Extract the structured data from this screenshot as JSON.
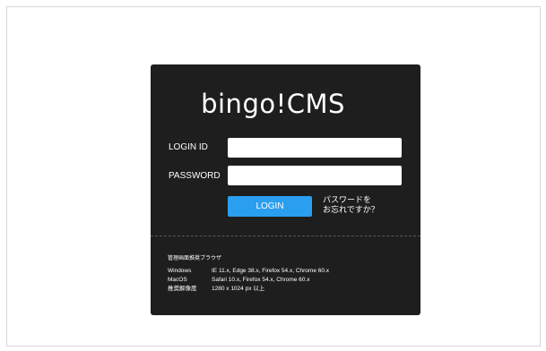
{
  "app": {
    "logo": "bingo!CMS"
  },
  "form": {
    "login_id_label": "LOGIN ID",
    "password_label": "PASSWORD",
    "login_id_value": "",
    "password_value": "",
    "login_button": "LOGIN",
    "forgot_line1": "パスワードを",
    "forgot_line2": "お忘れですか？"
  },
  "browsers": {
    "title": "管理画面推奨ブラウザ",
    "rows": [
      {
        "key": "Windows",
        "value": "IE 11.x, Edge 38.x, Firefox 54.x, Chrome 60.x"
      },
      {
        "key": "MacOS",
        "value": "Safari 10.x, Firefox 54.x, Chrome 60.x"
      },
      {
        "key": "推奨解像度",
        "value": "1280 x 1024 px 以上"
      }
    ]
  },
  "colors": {
    "panel_bg": "#1e1e1e",
    "button_bg": "#2a9ff0",
    "text": "#ffffff"
  }
}
